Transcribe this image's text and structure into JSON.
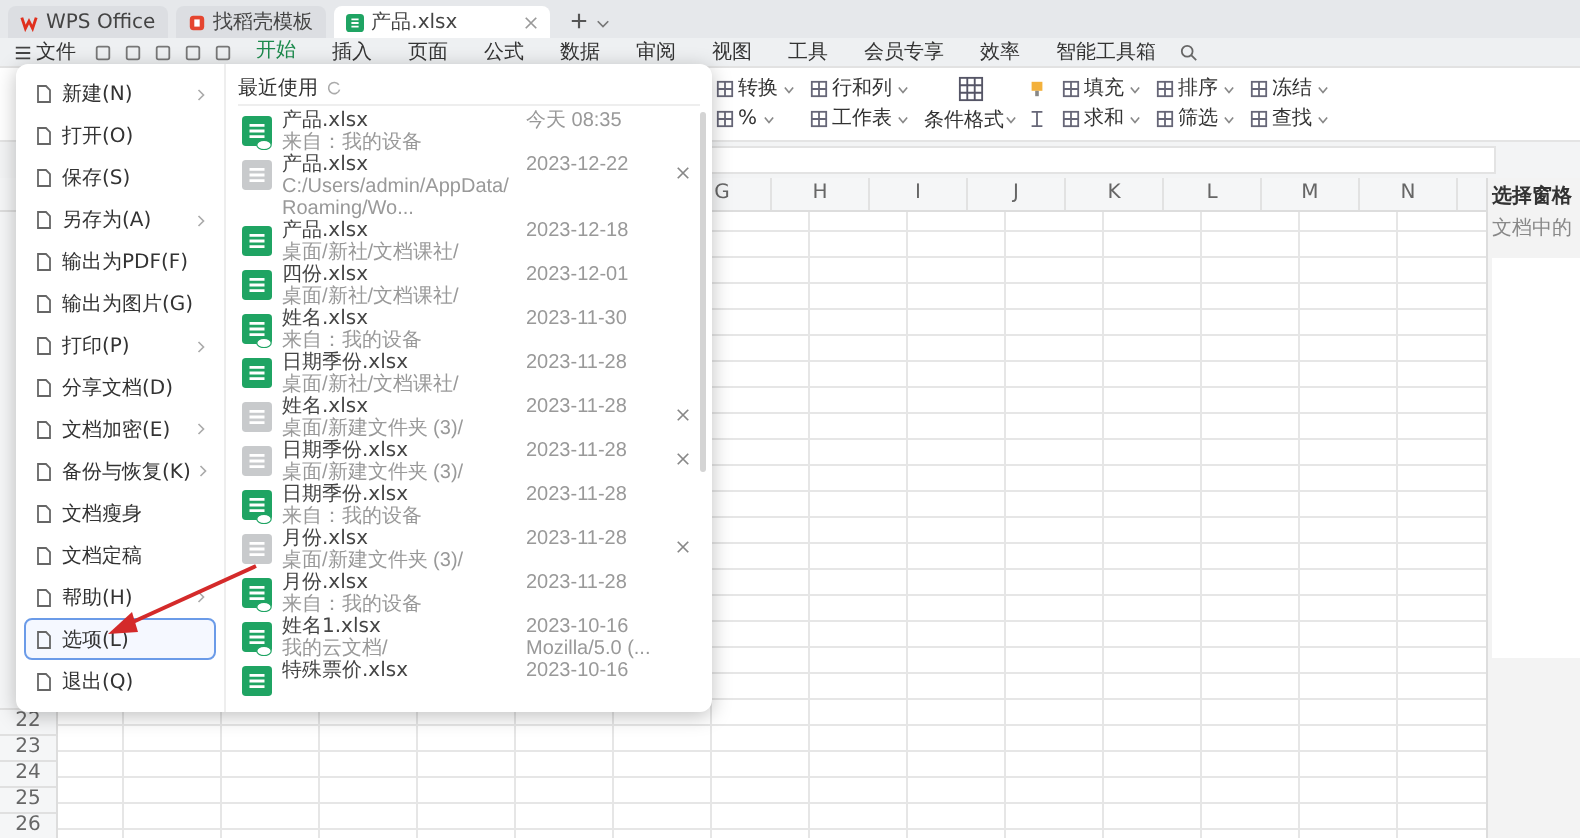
{
  "tabs": [
    {
      "label": "WPS Office",
      "kind": "home",
      "selected": false
    },
    {
      "label": "找稻壳模板",
      "kind": "template",
      "selected": false
    },
    {
      "label": "产品.xlsx",
      "kind": "sheet",
      "selected": true
    }
  ],
  "menu_bar": {
    "file_label": "文件",
    "items": [
      {
        "label": "开始",
        "selected": true
      },
      {
        "label": "插入",
        "selected": false
      },
      {
        "label": "页面",
        "selected": false
      },
      {
        "label": "公式",
        "selected": false
      },
      {
        "label": "数据",
        "selected": false
      },
      {
        "label": "审阅",
        "selected": false
      },
      {
        "label": "视图",
        "selected": false
      },
      {
        "label": "工具",
        "selected": false
      },
      {
        "label": "会员专享",
        "selected": false
      },
      {
        "label": "效率",
        "selected": false
      },
      {
        "label": "智能工具箱",
        "selected": false
      }
    ]
  },
  "ribbon": [
    {
      "kind": "stack",
      "labels": [
        "转换",
        "%"
      ]
    },
    {
      "kind": "stack",
      "labels": [
        "行和列",
        "工作表"
      ]
    },
    {
      "kind": "big",
      "labels": [
        "条件格式"
      ]
    },
    {
      "kind": "stack",
      "labels": [
        "填充",
        "求和"
      ]
    },
    {
      "kind": "stack",
      "labels": [
        "排序",
        "筛选"
      ]
    },
    {
      "kind": "stack",
      "labels": [
        "冻结",
        "查找"
      ]
    }
  ],
  "columns": [
    "G",
    "H",
    "I",
    "J",
    "K",
    "L",
    "M",
    "N"
  ],
  "row_numbers": [
    "22",
    "23",
    "24",
    "25",
    "26"
  ],
  "side_panel": {
    "title": "选择窗格",
    "subtitle": "文档中的"
  },
  "file_menu": [
    {
      "label": "新建(N)",
      "submenu": true,
      "selected": false
    },
    {
      "label": "打开(O)",
      "submenu": false,
      "selected": false
    },
    {
      "label": "保存(S)",
      "submenu": false,
      "selected": false
    },
    {
      "label": "另存为(A)",
      "submenu": true,
      "selected": false
    },
    {
      "label": "输出为PDF(F)",
      "submenu": false,
      "selected": false
    },
    {
      "label": "输出为图片(G)",
      "submenu": false,
      "selected": false
    },
    {
      "label": "打印(P)",
      "submenu": true,
      "selected": false
    },
    {
      "label": "分享文档(D)",
      "submenu": false,
      "selected": false
    },
    {
      "label": "文档加密(E)",
      "submenu": true,
      "selected": false
    },
    {
      "label": "备份与恢复(K)",
      "submenu": true,
      "selected": false
    },
    {
      "label": "文档瘦身",
      "submenu": false,
      "selected": false
    },
    {
      "label": "文档定稿",
      "submenu": false,
      "selected": false
    },
    {
      "label": "帮助(H)",
      "submenu": true,
      "selected": false
    },
    {
      "label": "选项(L)",
      "submenu": false,
      "selected": true
    },
    {
      "label": "退出(Q)",
      "submenu": false,
      "selected": false
    }
  ],
  "recent": {
    "title": "最近使用",
    "files": [
      {
        "name": "产品.xlsx",
        "location": "来自：我的设备",
        "date": "今天 08:35",
        "available": true,
        "cloud": true
      },
      {
        "name": "产品.xlsx",
        "location": "C:/Users/admin/AppData/Roaming/Wo...",
        "date": "2023-12-22",
        "available": false,
        "cloud": false
      },
      {
        "name": "产品.xlsx",
        "location": "桌面/新社/文档课社/",
        "date": "2023-12-18",
        "available": true,
        "cloud": false
      },
      {
        "name": "四份.xlsx",
        "location": "桌面/新社/文档课社/",
        "date": "2023-12-01",
        "available": true,
        "cloud": false
      },
      {
        "name": "姓名.xlsx",
        "location": "来自：我的设备",
        "date": "2023-11-30",
        "available": true,
        "cloud": true
      },
      {
        "name": "日期季份.xlsx",
        "location": "桌面/新社/文档课社/",
        "date": "2023-11-28",
        "available": true,
        "cloud": false
      },
      {
        "name": "姓名.xlsx",
        "location": "桌面/新建文件夹 (3)/",
        "date": "2023-11-28",
        "available": false,
        "cloud": false
      },
      {
        "name": "日期季份.xlsx",
        "location": "桌面/新建文件夹 (3)/",
        "date": "2023-11-28",
        "available": false,
        "cloud": false
      },
      {
        "name": "日期季份.xlsx",
        "location": "来自：我的设备",
        "date": "2023-11-28",
        "available": true,
        "cloud": true
      },
      {
        "name": "月份.xlsx",
        "location": "桌面/新建文件夹 (3)/",
        "date": "2023-11-28",
        "available": false,
        "cloud": false
      },
      {
        "name": "月份.xlsx",
        "location": "来自：我的设备",
        "date": "2023-11-28",
        "available": true,
        "cloud": true
      },
      {
        "name": "姓名1.xlsx",
        "location": "我的云文档/",
        "date": "2023-10-16",
        "extra": "Mozilla/5.0 (...",
        "available": true,
        "cloud": true
      },
      {
        "name": "特殊票价.xlsx",
        "date": "2023-10-16",
        "available": true,
        "cloud": false
      }
    ]
  }
}
